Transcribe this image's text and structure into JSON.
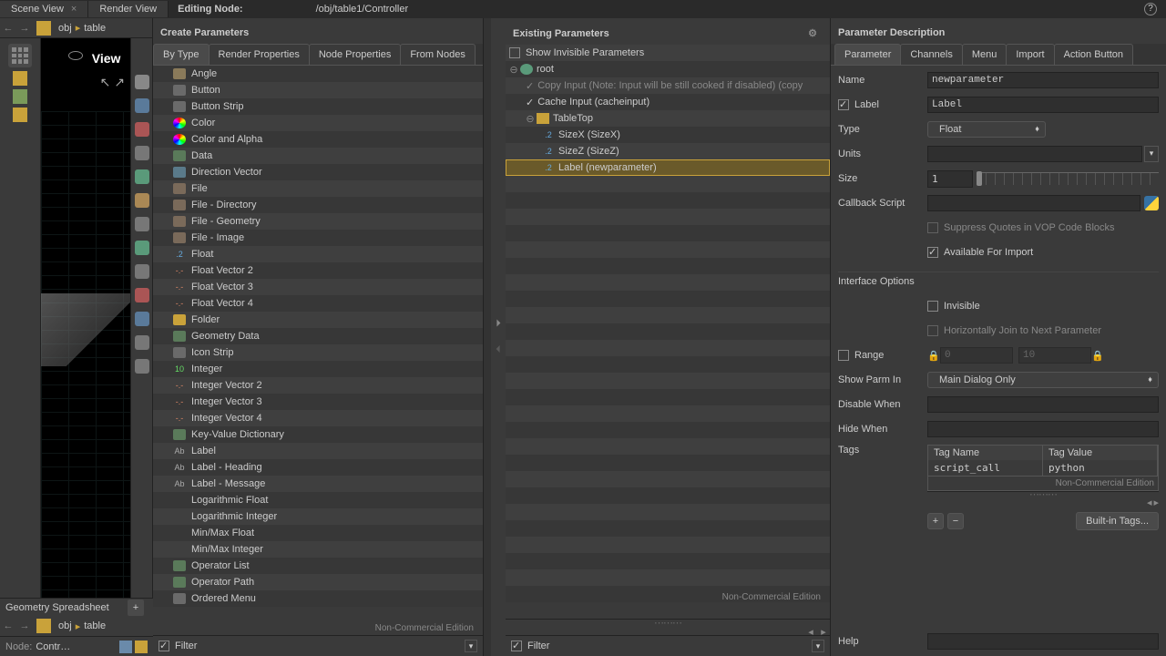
{
  "top": {
    "tabs": [
      "Scene View",
      "Render View"
    ],
    "editing_label": "Editing Node:",
    "editing_path": "/obj/table1/Controller"
  },
  "breadcrumb": {
    "seg1": "obj",
    "seg2": "table"
  },
  "viewport": {
    "label": "View"
  },
  "create": {
    "title": "Create Parameters",
    "tabs": [
      "By Type",
      "Render Properties",
      "Node Properties",
      "From Nodes"
    ],
    "filter": "Filter",
    "nce": "Non-Commercial Edition",
    "types": [
      {
        "l": "Angle",
        "c": "ic-angle"
      },
      {
        "l": "Button",
        "c": "ic-btn"
      },
      {
        "l": "Button Strip",
        "c": "ic-btn"
      },
      {
        "l": "Color",
        "c": "ic-color"
      },
      {
        "l": "Color and Alpha",
        "c": "ic-color"
      },
      {
        "l": "Data",
        "c": "ic-data"
      },
      {
        "l": "Direction Vector",
        "c": "ic-dir"
      },
      {
        "l": "File",
        "c": "ic-file"
      },
      {
        "l": "File - Directory",
        "c": "ic-file"
      },
      {
        "l": "File - Geometry",
        "c": "ic-file"
      },
      {
        "l": "File - Image",
        "c": "ic-file"
      },
      {
        "l": "Float",
        "c": "ic-float",
        "t": ".2"
      },
      {
        "l": "Float Vector 2",
        "c": "ic-vec",
        "t": "-.-"
      },
      {
        "l": "Float Vector 3",
        "c": "ic-vec",
        "t": "-.-"
      },
      {
        "l": "Float Vector 4",
        "c": "ic-vec",
        "t": "-.-"
      },
      {
        "l": "Folder",
        "c": "ic-folder"
      },
      {
        "l": "Geometry Data",
        "c": "ic-data"
      },
      {
        "l": "Icon Strip",
        "c": "ic-btn"
      },
      {
        "l": "Integer",
        "c": "ic-int",
        "t": "10"
      },
      {
        "l": "Integer Vector 2",
        "c": "ic-vec",
        "t": "-.-"
      },
      {
        "l": "Integer Vector 3",
        "c": "ic-vec",
        "t": "-.-"
      },
      {
        "l": "Integer Vector 4",
        "c": "ic-vec",
        "t": "-.-"
      },
      {
        "l": "Key-Value Dictionary",
        "c": "ic-data"
      },
      {
        "l": "Label",
        "c": "ic-label",
        "t": "Ab"
      },
      {
        "l": "Label - Heading",
        "c": "ic-label",
        "t": "Ab"
      },
      {
        "l": "Label - Message",
        "c": "ic-label",
        "t": "Ab"
      },
      {
        "l": "Logarithmic Float",
        "c": "ic-float"
      },
      {
        "l": "Logarithmic Integer",
        "c": "ic-int"
      },
      {
        "l": "Min/Max Float",
        "c": "ic-float"
      },
      {
        "l": "Min/Max Integer",
        "c": "ic-int"
      },
      {
        "l": "Operator List",
        "c": "ic-data"
      },
      {
        "l": "Operator Path",
        "c": "ic-data"
      },
      {
        "l": "Ordered Menu",
        "c": "ic-btn"
      }
    ]
  },
  "exist": {
    "title": "Existing Parameters",
    "show_invisible": "Show Invisible Parameters",
    "root": "root",
    "copy_input": "Copy Input (Note: Input will be still cooked if disabled) (copy",
    "cache_input": "Cache Input (cacheinput)",
    "tabletop": "TableTop",
    "sizex": "SizeX (SizeX)",
    "sizez": "SizeZ (SizeZ)",
    "label_new": "Label (newparameter)",
    "filter": "Filter",
    "nce": "Non-Commercial Edition"
  },
  "desc": {
    "title": "Parameter Description",
    "tabs": [
      "Parameter",
      "Channels",
      "Menu",
      "Import",
      "Action Button"
    ],
    "name": "Name",
    "name_val": "newparameter",
    "label": "Label",
    "label_val": "Label",
    "type": "Type",
    "type_val": "Float",
    "units": "Units",
    "units_val": "",
    "size": "Size",
    "size_val": "1",
    "callback": "Callback Script",
    "callback_val": "",
    "suppress": "Suppress Quotes in VOP Code Blocks",
    "avail": "Available For Import",
    "iface": "Interface Options",
    "invisible": "Invisible",
    "hjoin": "Horizontally Join to Next Parameter",
    "range": "Range",
    "range_lo": "0",
    "range_hi": "10",
    "showin": "Show Parm In",
    "showin_val": "Main Dialog Only",
    "disable": "Disable When",
    "hide": "Hide When",
    "tags": "Tags",
    "tag_name_h": "Tag Name",
    "tag_val_h": "Tag Value",
    "tag_name": "script_call",
    "tag_val": "python",
    "nce": "Non-Commercial Edition",
    "builtin": "Built-in Tags...",
    "help": "Help"
  },
  "bottom": {
    "geom_tab": "Geometry Spreadsheet",
    "node_label": "Node:",
    "node_val": "Contr…"
  }
}
